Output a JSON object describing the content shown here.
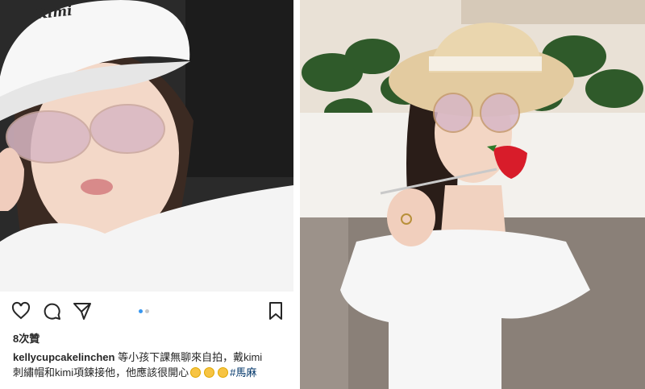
{
  "post": {
    "photo_alt": "selfie with white cap and sunglasses",
    "cap_text": "Kimi",
    "icons": [
      "heart-icon",
      "comment-icon",
      "send-icon",
      "bookmark-icon"
    ],
    "likes": "8次贊",
    "username": "kellycupcakelinchen",
    "caption_line1": " 等小孩下課無聊來自拍，戴kimi",
    "caption_line2": "刺繡帽和kimi項鍊接他，他應該很開心",
    "hashtag": "#馬麻"
  },
  "photo2": {
    "photo_alt": "woman in straw hat eating strawberry"
  }
}
